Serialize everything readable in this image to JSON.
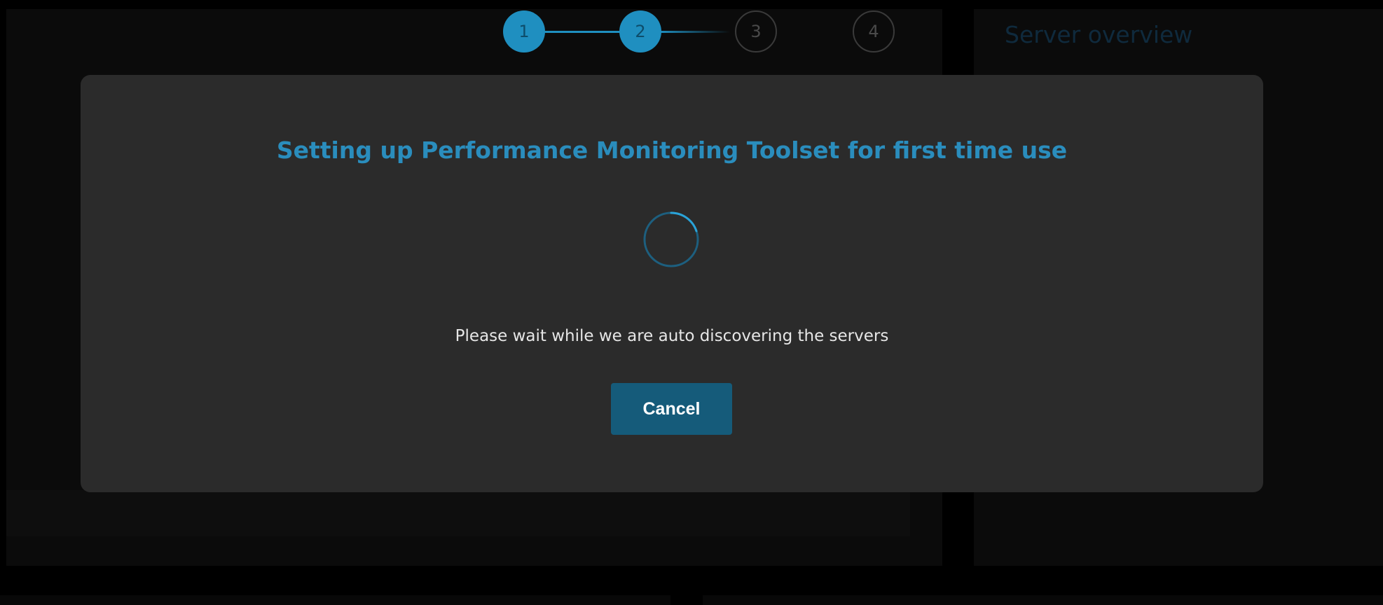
{
  "background": {
    "right_panel_title": "Server overview"
  },
  "stepper": {
    "steps": [
      {
        "label": "1",
        "state": "completed"
      },
      {
        "label": "2",
        "state": "current"
      },
      {
        "label": "3",
        "state": "pending"
      },
      {
        "label": "4",
        "state": "pending"
      }
    ]
  },
  "modal": {
    "title": "Setting up Performance Monitoring Toolset for first time use",
    "message": "Please wait while we are auto discovering the servers",
    "cancel_label": "Cancel",
    "spinner_icon": "loading-spinner-icon"
  },
  "colors": {
    "accent": "#1f8fc0",
    "title": "#2a8dbd",
    "button": "#155b7a",
    "modal_bg": "#2b2b2b",
    "page_bg": "#000000"
  }
}
